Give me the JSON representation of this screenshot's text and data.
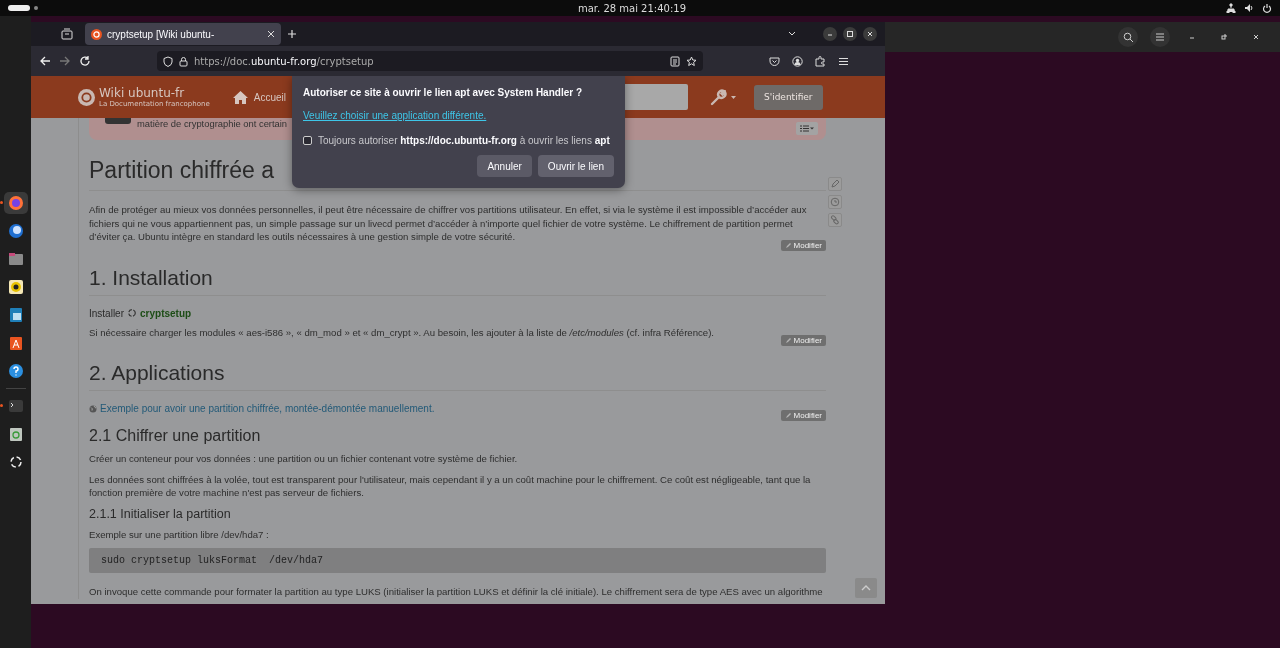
{
  "topbar": {
    "clock": "mar. 28 mai  21:40:19"
  },
  "dock": {
    "apps": [
      {
        "kind": "firefox",
        "running": true,
        "selected": true
      },
      {
        "kind": "mail",
        "running": false,
        "selected": false
      },
      {
        "kind": "files",
        "running": false,
        "selected": false
      },
      {
        "kind": "music",
        "running": false,
        "selected": false
      },
      {
        "kind": "writer",
        "running": false,
        "selected": false
      },
      {
        "kind": "store",
        "running": false,
        "selected": false
      },
      {
        "kind": "help",
        "running": false,
        "selected": false
      },
      {
        "kind": "terminal",
        "running": true,
        "selected": false
      },
      {
        "kind": "trash",
        "running": false,
        "selected": false
      },
      {
        "kind": "apps",
        "running": false,
        "selected": false
      }
    ]
  },
  "browser": {
    "tab": {
      "title": "cryptsetup [Wiki ubuntu-"
    },
    "url": {
      "scheme": "https://doc.",
      "host": "ubuntu-fr.org",
      "path": "/cryptsetup"
    }
  },
  "site": {
    "logo_title": "Wiki ubuntu-fr",
    "logo_subtitle": "La Documentation francophone",
    "nav": "Accueil",
    "login": "S'identifier"
  },
  "article": {
    "notice": "matière de cryptographie ont certain",
    "title": "Partition chiffrée a",
    "blocks": [
      {
        "kind": "p",
        "text": "Afin de protéger au mieux vos données personnelles, il peut être nécessaire de chiffrer vos partitions utilisateur. En effet, si via le système il est impossible d’accéder aux fichiers qui ne vous appartiennent pas, un simple passage sur un livecd permet d’accéder à n’importe quel fichier de votre système. Le chiffrement de partition permet d’éviter ça. Ubuntu intègre en standard les outils nécessaires à une gestion simple de votre sécurité."
      },
      {
        "kind": "edit",
        "text": "Modifier"
      },
      {
        "kind": "h1",
        "text": "1. Installation"
      },
      {
        "kind": "install",
        "text": "Installer",
        "package": "cryptsetup"
      },
      {
        "kind": "p",
        "text": "Si nécessaire charger les modules « aes-i586 », « dm_mod » et « dm_crypt ». Au besoin, les ajouter à la liste de */etc/modules* (cf. infra Référence)."
      },
      {
        "kind": "edit",
        "text": "Modifier"
      },
      {
        "kind": "h1",
        "text": "2. Applications"
      },
      {
        "kind": "link",
        "text": "Exemple pour avoir une partition chiffrée, montée-démontée manuellement."
      },
      {
        "kind": "edit",
        "text": "Modifier"
      },
      {
        "kind": "h2",
        "text": "2.1 Chiffrer une partition"
      },
      {
        "kind": "p",
        "text": "Créer un conteneur pour vos données : une partition ou un fichier contenant votre système de fichier."
      },
      {
        "kind": "p",
        "text": "Les données sont chiffrées à la volée, tout est transparent pour l'utilisateur, mais cependant il y a un coût machine pour le chiffrement. Ce coût est négligeable, tant que la fonction première de votre machine n'est pas serveur de fichiers."
      },
      {
        "kind": "h3",
        "text": "2.1.1 Initialiser la partition"
      },
      {
        "kind": "p",
        "text": "Exemple sur une partition libre /dev/hda7 :"
      },
      {
        "kind": "code",
        "text": "sudo cryptsetup luksFormat  /dev/hda7"
      },
      {
        "kind": "p",
        "text": "On invoque cette commande pour formater la partition au type LUKS (initialiser la partition LUKS et définir la clé initiale). Le chiffrement sera de type AES avec un algorithme"
      }
    ]
  },
  "dialog": {
    "title": "Autoriser ce site à ouvrir le lien apt avec System Handler ?",
    "link": "Veuillez choisir une application différente.",
    "remember": {
      "checked": false,
      "label": "Toujours autoriser **https://doc.ubuntu-fr.org** à ouvrir les liens **apt**"
    },
    "buttons": [
      {
        "label": "Annuler",
        "kind": "secondary"
      },
      {
        "label": "Ouvrir le lien",
        "kind": "primary"
      }
    ]
  }
}
